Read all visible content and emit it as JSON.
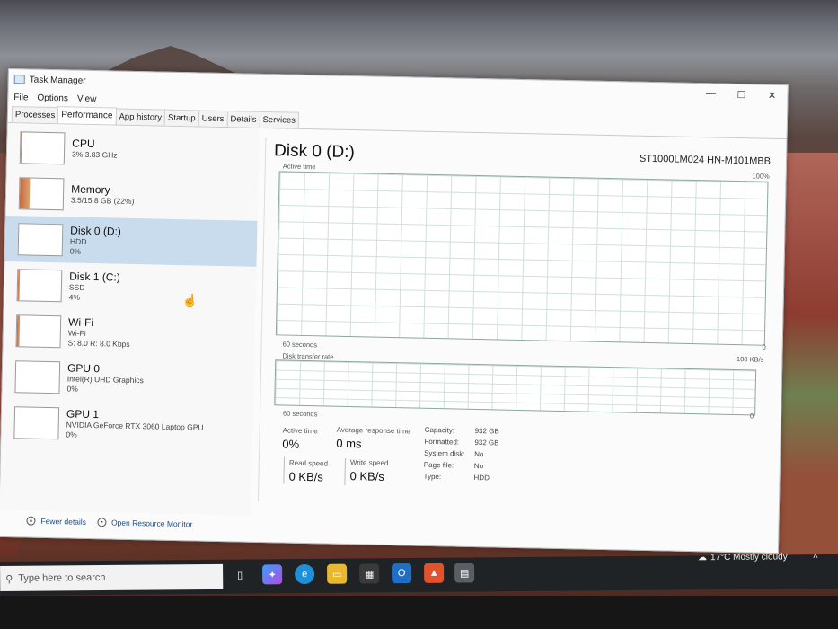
{
  "window": {
    "title": "Task Manager",
    "minimize": "—",
    "maximize": "☐",
    "close": "✕"
  },
  "menu": [
    "File",
    "Options",
    "View"
  ],
  "tabs": [
    "Processes",
    "Performance",
    "App history",
    "Startup",
    "Users",
    "Details",
    "Services"
  ],
  "sidebar": [
    {
      "title": "CPU",
      "sub1": "3% 3.83 GHz",
      "sub2": "",
      "fill": 0.03
    },
    {
      "title": "Memory",
      "sub1": "3.5/15.8 GB (22%)",
      "sub2": "",
      "fill": 0.22
    },
    {
      "title": "Disk 0 (D:)",
      "sub1": "HDD",
      "sub2": "0%",
      "fill": 0
    },
    {
      "title": "Disk 1 (C:)",
      "sub1": "SSD",
      "sub2": "4%",
      "fill": 0.04
    },
    {
      "title": "Wi-Fi",
      "sub1": "Wi-Fi",
      "sub2": "S: 8.0 R: 8.0 Kbps",
      "fill": 0.06
    },
    {
      "title": "GPU 0",
      "sub1": "Intel(R) UHD Graphics",
      "sub2": "0%",
      "fill": 0
    },
    {
      "title": "GPU 1",
      "sub1": "NVIDIA GeForce RTX 3060 Laptop GPU",
      "sub2": "0%",
      "fill": 0
    }
  ],
  "detail": {
    "title": "Disk 0 (D:)",
    "model": "ST1000LM024 HN-M101MBB",
    "active_label": "Active time",
    "active_max": "100%",
    "axis_time": "60 seconds",
    "axis_min": "0",
    "transfer_label": "Disk transfer rate",
    "transfer_max": "100 KB/s",
    "stats": {
      "active_time_label": "Active time",
      "active_time": "0%",
      "avg_resp_label": "Average response time",
      "avg_resp": "0 ms",
      "read_label": "Read speed",
      "read": "0 KB/s",
      "write_label": "Write speed",
      "write": "0 KB/s"
    },
    "props": [
      {
        "k": "Capacity:",
        "v": "932 GB"
      },
      {
        "k": "Formatted:",
        "v": "932 GB"
      },
      {
        "k": "System disk:",
        "v": "No"
      },
      {
        "k": "Page file:",
        "v": "No"
      },
      {
        "k": "Type:",
        "v": "HDD"
      }
    ]
  },
  "footer": {
    "fewer": "Fewer details",
    "monitor": "Open Resource Monitor"
  },
  "taskbar": {
    "search_placeholder": "Type here to search",
    "weather": "17°C  Mostly cloudy"
  }
}
